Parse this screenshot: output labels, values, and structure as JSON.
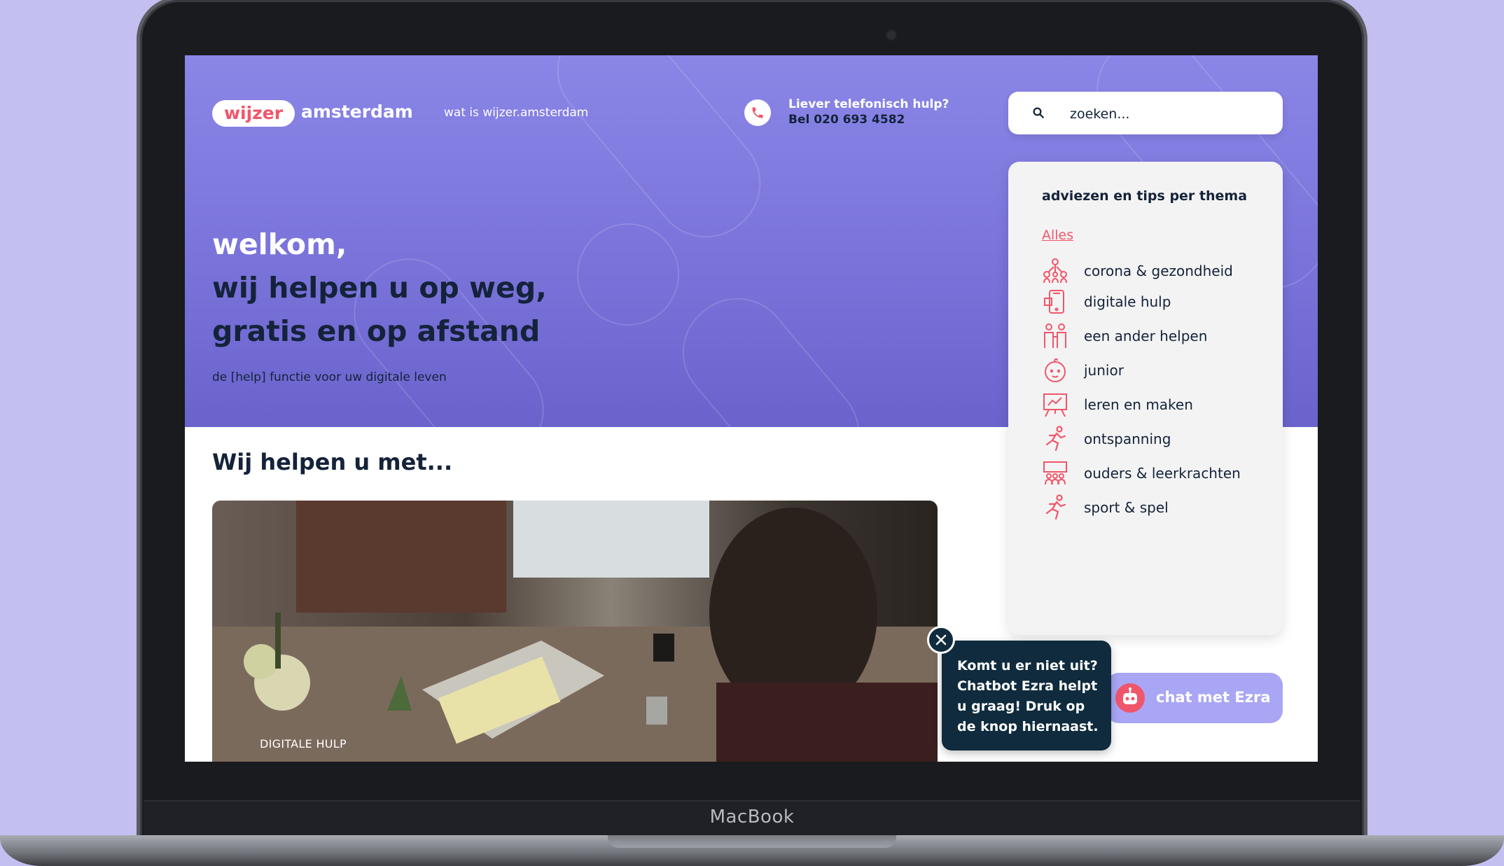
{
  "device": {
    "brand_label": "MacBook"
  },
  "header": {
    "logo_pill": "wijzer",
    "logo_text": "amsterdam",
    "nav_link": "wat is wijzer.amsterdam",
    "phone_line1": "Liever telefonisch hulp?",
    "phone_line2": "Bel 020 693 4582",
    "search_placeholder": "zoeken..."
  },
  "hero": {
    "welcome": "welkom,",
    "line2": "wij helpen u op weg,",
    "line3": "gratis en op afstand",
    "subtitle": "de [help] functie voor uw digitale leven"
  },
  "main": {
    "section_title": "Wij helpen u met...",
    "card_label": "DIGITALE HULP"
  },
  "themes_panel": {
    "title": "adviezen en tips per thema",
    "all_link": "Alles",
    "items": [
      {
        "label": "corona & gezondheid",
        "icon": "people-network-icon"
      },
      {
        "label": "digitale hulp",
        "icon": "smartphone-icon"
      },
      {
        "label": "een ander helpen",
        "icon": "two-people-icon"
      },
      {
        "label": "junior",
        "icon": "baby-face-icon"
      },
      {
        "label": "leren en maken",
        "icon": "presentation-board-icon"
      },
      {
        "label": "ontspanning",
        "icon": "running-person-icon"
      },
      {
        "label": "ouders & leerkrachten",
        "icon": "classroom-icon"
      },
      {
        "label": "sport & spel",
        "icon": "running-person-icon"
      }
    ]
  },
  "chatbot": {
    "bubble_text": "Komt u er niet uit? Chatbot Ezra helpt u graag! Druk op de knop hiernaast.",
    "button_label": "chat met Ezra"
  },
  "colors": {
    "hero_purple": "#7d77dd",
    "accent_red": "#f0566b",
    "dark_navy": "#14233a",
    "chat_button": "#a9a6f5",
    "bubble": "#0f2b3d"
  }
}
